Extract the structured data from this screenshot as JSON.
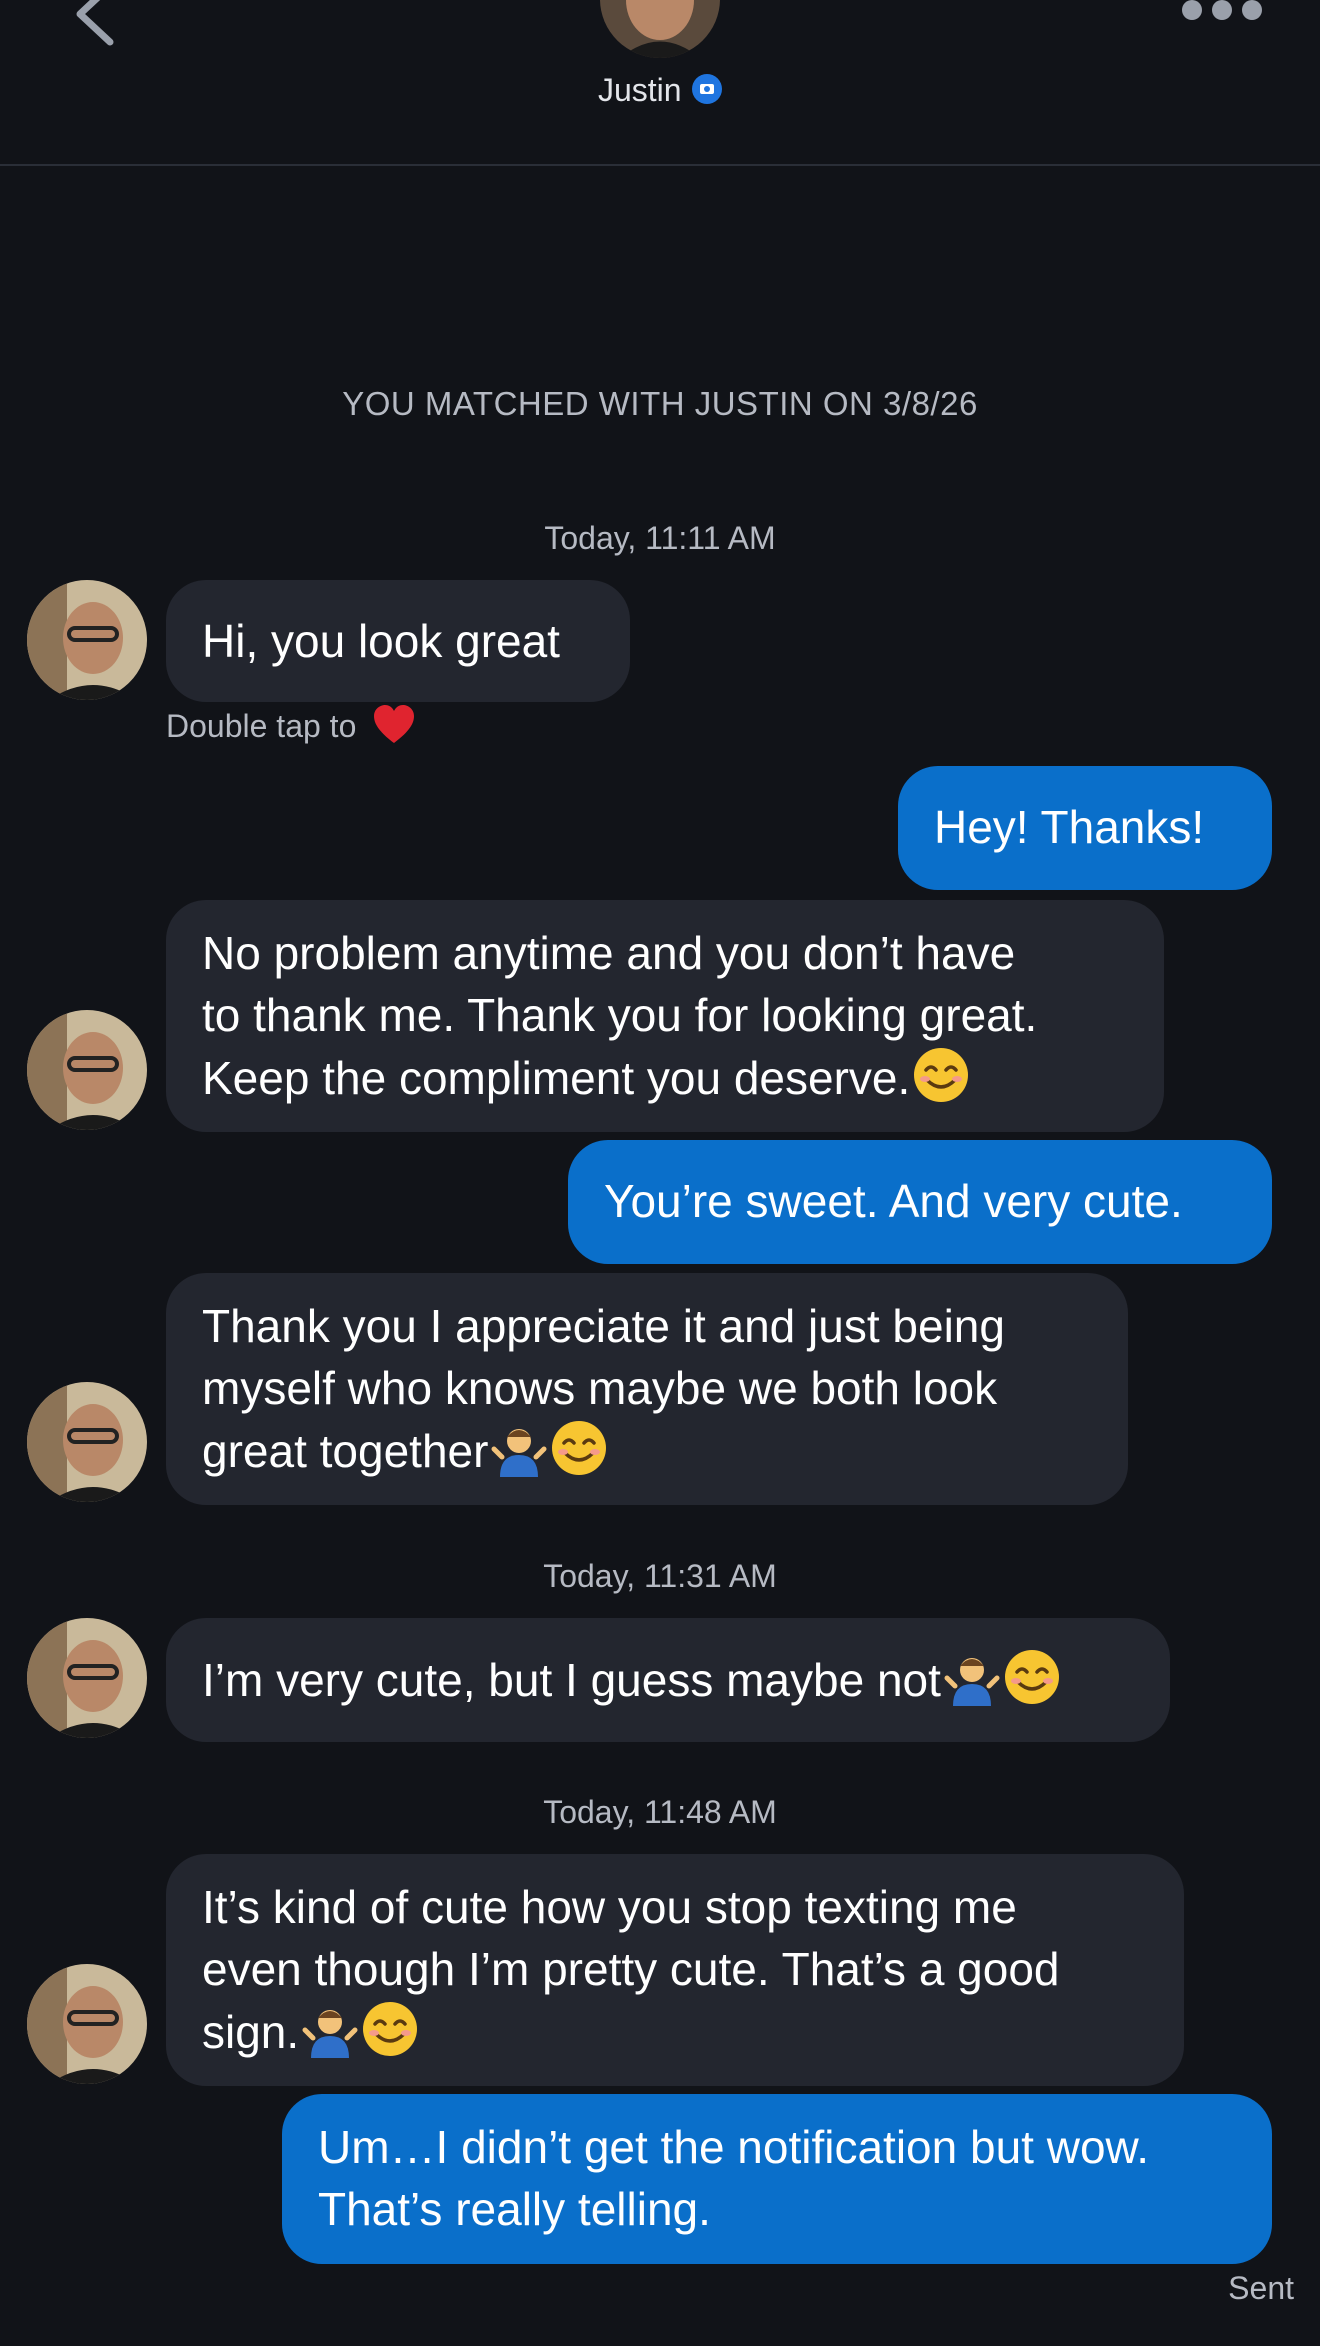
{
  "header": {
    "contact_name": "Justin"
  },
  "match_banner": "YOU MATCHED WITH JUSTIN ON 3/8/26",
  "timestamps": [
    "Today, 11:11 AM",
    "Today, 11:31 AM",
    "Today, 11:48 AM"
  ],
  "messages": [
    {
      "direction": "incoming",
      "lines": [
        "Hi, you look great"
      ]
    },
    {
      "direction": "outgoing",
      "lines": [
        "Hey! Thanks!"
      ]
    },
    {
      "direction": "incoming",
      "lines": [
        "No problem anytime and you don’t have",
        "to thank me. Thank you for looking great.",
        "Keep the compliment you deserve."
      ],
      "emojis": [
        "smiling-face-emoji"
      ]
    },
    {
      "direction": "outgoing",
      "lines": [
        "You’re sweet. And very cute."
      ]
    },
    {
      "direction": "incoming",
      "lines": [
        "Thank you I appreciate it and just being",
        "myself who knows maybe we both look",
        "great together"
      ],
      "emojis": [
        "man-shrugging-emoji",
        "smiling-face-emoji"
      ]
    },
    {
      "direction": "incoming",
      "lines": [
        "I’m very cute, but I guess maybe not"
      ],
      "emojis": [
        "man-shrugging-emoji",
        "smiling-face-emoji"
      ]
    },
    {
      "direction": "incoming",
      "lines": [
        "It’s kind of cute how you stop texting me",
        "even though I’m pretty cute. That’s a good",
        "sign."
      ],
      "emojis": [
        "man-shrugging-emoji",
        "smiling-face-emoji"
      ]
    },
    {
      "direction": "outgoing",
      "lines": [
        "Um…I didn’t get the notification but wow.",
        "That’s really telling."
      ]
    }
  ],
  "like_hint": "Double tap to",
  "delivery_status": "Sent",
  "colors": {
    "background": "#111318",
    "incoming_bubble": "#23262f",
    "outgoing_bubble": "#0a6fca",
    "verified_badge": "#1f75e0",
    "heart": "#e0242f"
  }
}
